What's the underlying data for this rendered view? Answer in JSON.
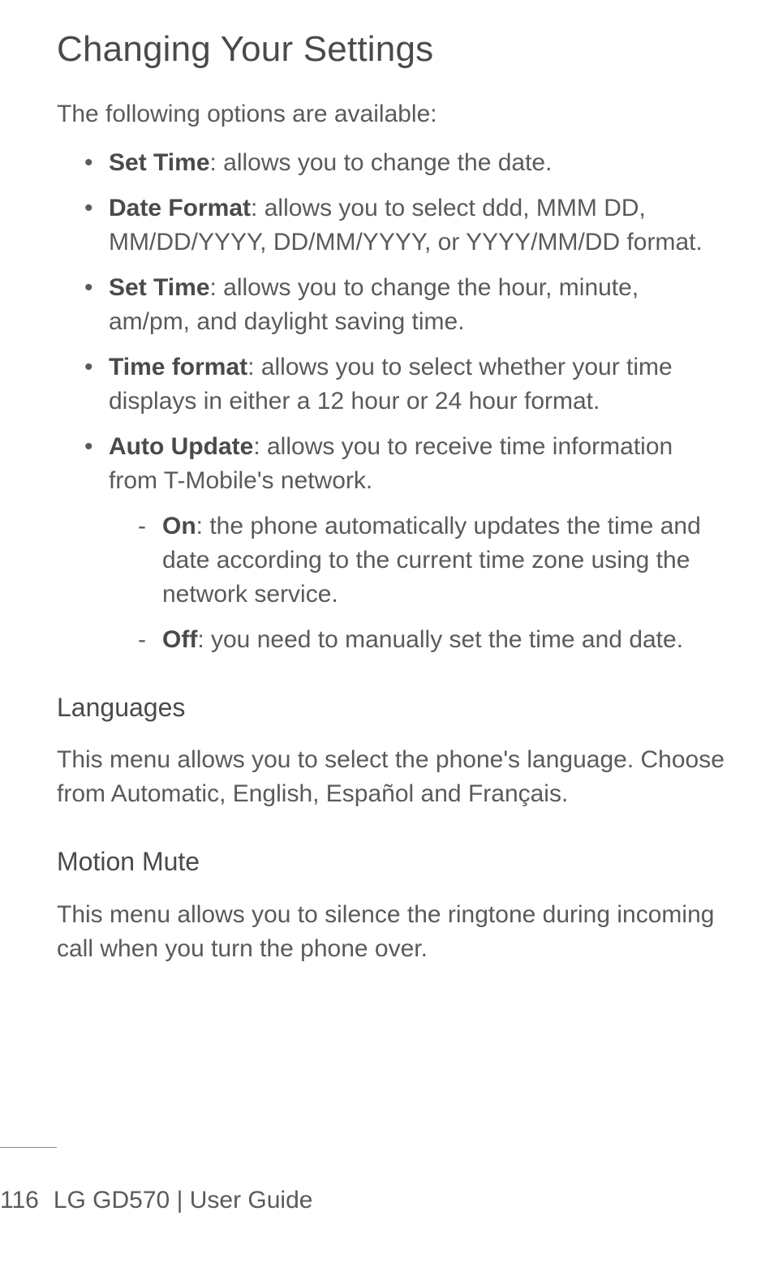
{
  "title": "Changing Your Settings",
  "intro": "The following options are available:",
  "items": [
    {
      "label": "Set Time",
      "desc": ": allows you to change the date."
    },
    {
      "label": "Date Format",
      "desc": ": allows you to select ddd, MMM DD, MM/DD/YYYY, DD/MM/YYYY, or YYYY/MM/DD format."
    },
    {
      "label": "Set Time",
      "desc": ": allows you to change the hour, minute, am/pm, and daylight saving time."
    },
    {
      "label": "Time format",
      "desc": ": allows you to select whether your time displays in either a 12 hour or 24 hour format."
    },
    {
      "label": "Auto Update",
      "desc": ": allows you to receive time information from T-Mobile's network.",
      "sub": [
        {
          "label": "On",
          "desc": ": the phone automatically updates the time and date according to the current time zone using the network service."
        },
        {
          "label": "Off",
          "desc": ": you need to manually set the time and date."
        }
      ]
    }
  ],
  "languages": {
    "heading": "Languages",
    "body": "This menu allows you to select the phone's language. Choose from Automatic, English, Español and Français."
  },
  "motion_mute": {
    "heading": "Motion Mute",
    "body": "This menu allows you to silence the ringtone during incoming call when you turn the phone over."
  },
  "footer": {
    "page": "116",
    "model": "LG GD570",
    "sep": "  |  ",
    "guide": "User Guide"
  }
}
